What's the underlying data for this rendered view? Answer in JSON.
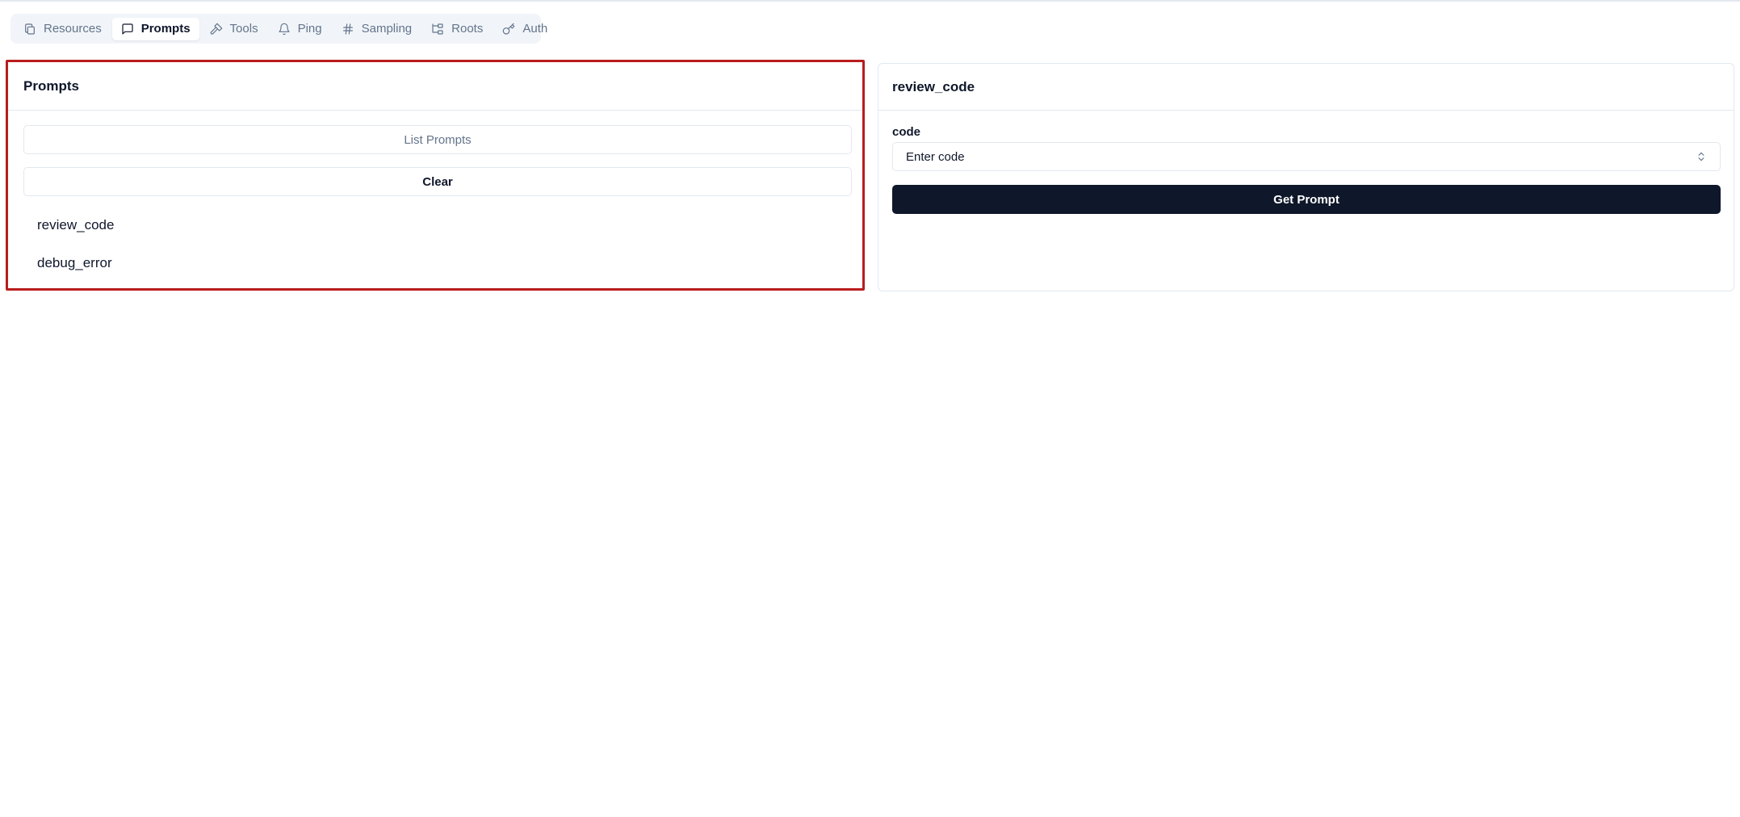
{
  "tabs": [
    {
      "label": "Resources",
      "icon": "copy-icon"
    },
    {
      "label": "Prompts",
      "icon": "message-square-icon"
    },
    {
      "label": "Tools",
      "icon": "hammer-icon"
    },
    {
      "label": "Ping",
      "icon": "bell-icon"
    },
    {
      "label": "Sampling",
      "icon": "hash-icon"
    },
    {
      "label": "Roots",
      "icon": "folder-tree-icon"
    },
    {
      "label": "Auth",
      "icon": "key-icon"
    }
  ],
  "active_tab": "Prompts",
  "prompts_panel": {
    "title": "Prompts",
    "list_button": "List Prompts",
    "clear_button": "Clear",
    "items": [
      "review_code",
      "debug_error"
    ]
  },
  "detail_panel": {
    "title": "review_code",
    "field_label": "code",
    "field_value": "Enter code",
    "submit_button": "Get Prompt"
  },
  "colors": {
    "accent_dark": "#0f172a",
    "highlight_border": "#b91c1c",
    "muted_text": "#64748b",
    "tab_bar_bg": "#f1f5f9"
  }
}
